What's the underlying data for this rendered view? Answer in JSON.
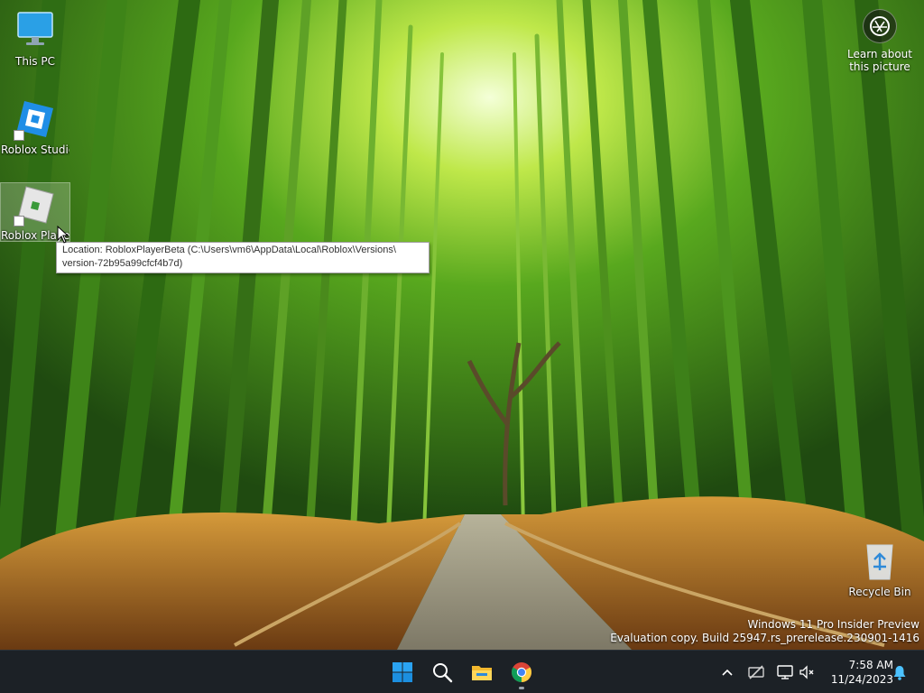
{
  "desktop": {
    "icons": [
      {
        "label": "This PC",
        "icon": "this-pc-icon"
      },
      {
        "label": "Roblox Studio",
        "icon": "roblox-studio-icon"
      },
      {
        "label": "Roblox Player",
        "icon": "roblox-player-icon"
      }
    ],
    "recycle_bin": {
      "label": "Recycle Bin",
      "icon": "recycle-bin-icon"
    },
    "learn_about_picture": {
      "line1": "Learn about",
      "line2": "this picture",
      "icon": "camera-icon"
    }
  },
  "tooltip": {
    "line1": "Location: RobloxPlayerBeta (C:\\Users\\vm6\\AppData\\Local\\Roblox\\Versions\\",
    "line2": "version-72b95a99cfcf4b7d)"
  },
  "watermark": {
    "line1": "Windows 11 Pro Insider Preview",
    "line2": "Evaluation copy. Build 25947.rs_prerelease.230901-1416"
  },
  "taskbar": {
    "apps": [
      {
        "name": "Start",
        "icon": "windows-start-icon"
      },
      {
        "name": "Search",
        "icon": "search-icon"
      },
      {
        "name": "File Explorer",
        "icon": "file-explorer-icon"
      },
      {
        "name": "Google Chrome",
        "icon": "chrome-icon",
        "running": true
      }
    ],
    "tray": {
      "icons": [
        "chevron-up-icon",
        "network-disconnected-icon",
        "display-icon",
        "volume-muted-icon",
        "notification-bell-icon"
      ],
      "time": "7:58 AM",
      "date": "11/24/2023"
    },
    "colors": {
      "background": "#1c2126",
      "accent": "#0078d4"
    }
  }
}
